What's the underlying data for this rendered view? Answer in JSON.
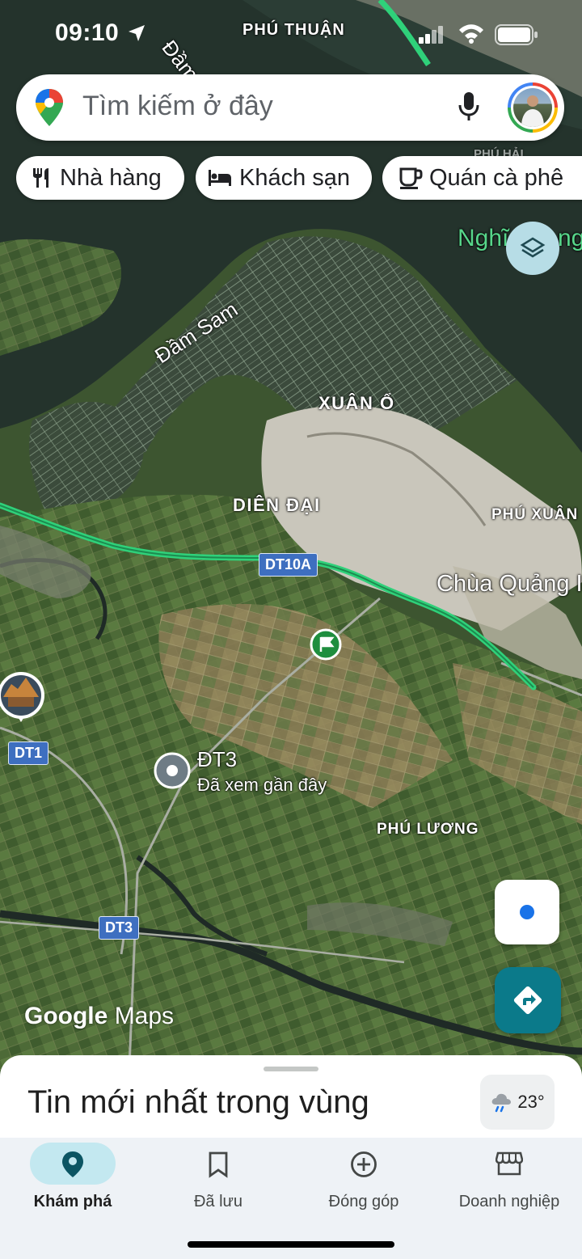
{
  "status_bar": {
    "time": "09:10",
    "map_label_top": "PHÚ THUẬN"
  },
  "search": {
    "placeholder": "Tìm kiếm ở đây",
    "icons": [
      "maps-pin-icon",
      "mic-icon",
      "profile-avatar"
    ]
  },
  "chips": [
    {
      "label": "Nhà hàng",
      "icon": "restaurant-icon"
    },
    {
      "label": "Khách sạn",
      "icon": "hotel-icon"
    },
    {
      "label": "Quán cà phê",
      "icon": "coffee-icon"
    }
  ],
  "map": {
    "labels": {
      "dam_th": "Đầm Th",
      "dam_sam": "Đầm Sam",
      "xuan_o": "XUÂN Ổ",
      "dien_dai": "DIÊN ĐẠI",
      "phu_xuan": "PHÚ XUÂN",
      "chua_quang": "Chùa Quảng I",
      "phu_luong": "PHÚ LƯƠNG",
      "nghi": "Nghĩ",
      "nghi_tail": "ng",
      "phu_hai": "PHÚ HẢI"
    },
    "road_shields": {
      "dt10a": "DT10A",
      "dt1": "DT1",
      "dt3": "DT3"
    },
    "place": {
      "name": "ĐT3",
      "subtitle": "Đã xem gần đây"
    }
  },
  "google_logo": {
    "google": "Google",
    "maps": "Maps"
  },
  "sheet": {
    "title": "Tin mới nhất trong vùng",
    "weather": "23°"
  },
  "nav": [
    {
      "label": "Khám phá",
      "icon": "explore-pin-icon",
      "active": true
    },
    {
      "label": "Đã lưu",
      "icon": "bookmark-icon",
      "active": false
    },
    {
      "label": "Đóng góp",
      "icon": "add-circle-icon",
      "active": false
    },
    {
      "label": "Doanh nghiệp",
      "icon": "storefront-icon",
      "active": false
    }
  ],
  "colors": {
    "accent": "#0b7a8a",
    "road_green": "#2fd17a",
    "shield_blue": "#3e6fc0",
    "nav_active_pill": "#c3e8f0"
  }
}
